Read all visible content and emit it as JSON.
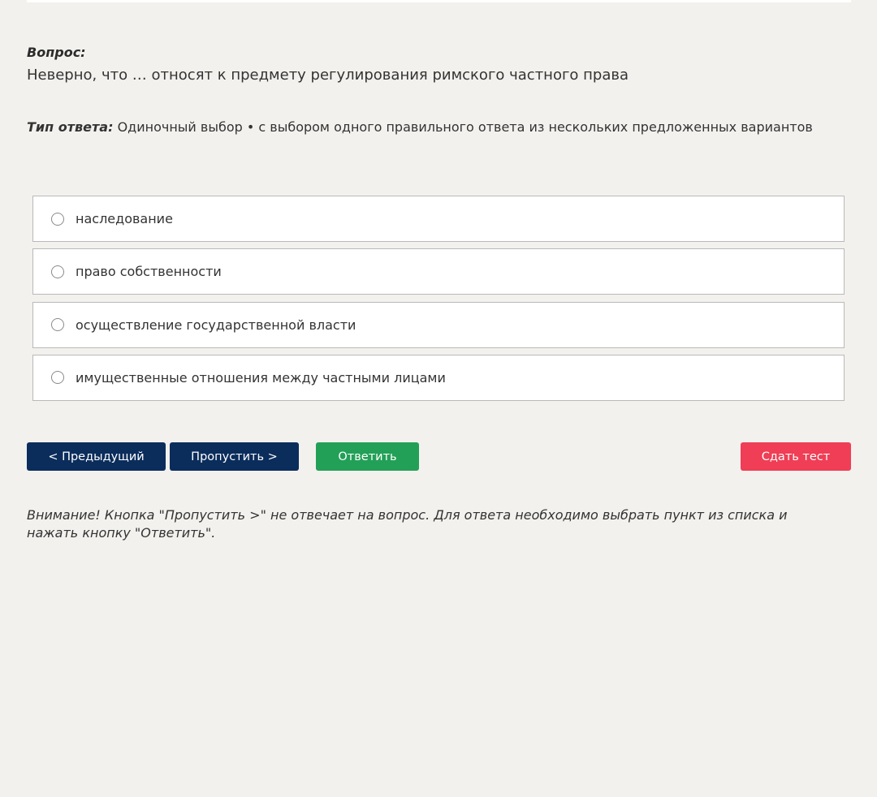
{
  "question": {
    "label": "Вопрос:",
    "text": "Неверно, что … относят к предмету регулирования римского частного права"
  },
  "answer_type": {
    "label": "Тип ответа:",
    "value": "Одиночный выбор • с выбором одного правильного ответа из нескольких предложенных вариантов"
  },
  "options": [
    {
      "label": "наследование",
      "selected": false
    },
    {
      "label": "право собственности",
      "selected": false
    },
    {
      "label": "осуществление государственной власти",
      "selected": false
    },
    {
      "label": "имущественные отношения между частными лицами",
      "selected": false
    }
  ],
  "buttons": {
    "prev": "< Предыдущий",
    "skip": "Пропустить >",
    "answer": "Ответить",
    "submit": "Сдать тест"
  },
  "notice": "Внимание! Кнопка \"Пропустить >\" не отвечает на вопрос. Для ответа необходимо выбрать пункт из списка и нажать кнопку \"Ответить\".",
  "colors": {
    "background": "#f3f1ee",
    "primary_button": "#0b2d5c",
    "answer_button": "#23a057",
    "submit_button": "#ef3e55"
  }
}
